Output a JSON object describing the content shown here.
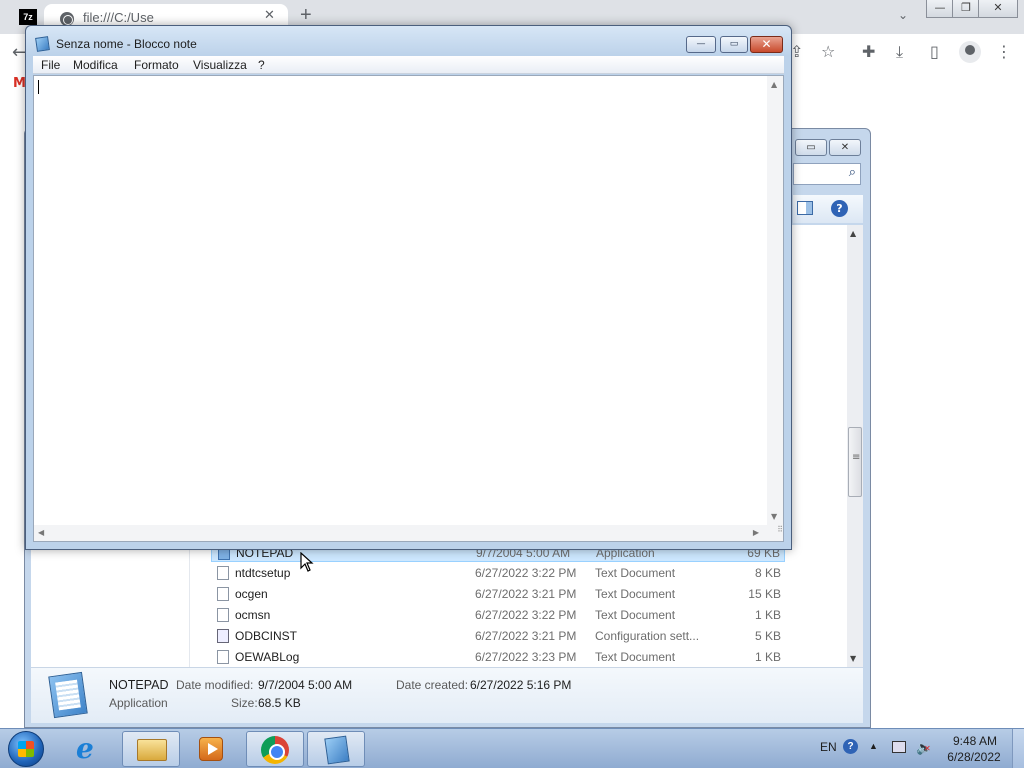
{
  "chrome": {
    "app_icon_label": "7z",
    "tab_title": "file:///C:/Use",
    "tab_close": "✕",
    "new_tab": "+",
    "tab_search_chevron": "⌄",
    "window_min": "—",
    "window_restore": "❐",
    "window_close": "✕",
    "back_arrow": "←",
    "toolbar_icons": [
      "share-icon",
      "star-icon",
      "extensions-icon",
      "download-icon",
      "sidebar-icon",
      "profile-icon",
      "menu-icon"
    ],
    "toolbar_glyphs": [
      "⇪",
      "☆",
      "✚",
      "⤓",
      "▯",
      "⋮"
    ],
    "bookmark_gmail": "M"
  },
  "notepad": {
    "title": "Senza nome - Blocco note",
    "menu": [
      "File",
      "Modifica",
      "Formato",
      "Visualizza",
      "?"
    ],
    "content": "",
    "buttons": {
      "minimize": "—",
      "maximize": "▭",
      "close": "✕"
    },
    "scroll_glyphs": {
      "up": "▲",
      "down": "▼",
      "left": "◀",
      "right": "▶",
      "grip": "⠿"
    }
  },
  "explorer": {
    "search_icon": "⌕",
    "help_label": "?",
    "buttons": {
      "maximize": "▭",
      "close": "✕"
    },
    "scroll_glyphs": {
      "up": "▲",
      "down": "▼"
    },
    "files": [
      {
        "name": "NOTEPAD",
        "date": "9/7/2004 5:00 AM",
        "type": "Application",
        "size": "69 KB",
        "icon": "application-icon",
        "selected": true
      },
      {
        "name": "ntdtcsetup",
        "date": "6/27/2022 3:22 PM",
        "type": "Text Document",
        "size": "8 KB",
        "icon": "text-document-icon",
        "selected": false
      },
      {
        "name": "ocgen",
        "date": "6/27/2022 3:21 PM",
        "type": "Text Document",
        "size": "15 KB",
        "icon": "text-document-icon",
        "selected": false
      },
      {
        "name": "ocmsn",
        "date": "6/27/2022 3:22 PM",
        "type": "Text Document",
        "size": "1 KB",
        "icon": "text-document-icon",
        "selected": false
      },
      {
        "name": "ODBCINST",
        "date": "6/27/2022 3:21 PM",
        "type": "Configuration sett...",
        "size": "5 KB",
        "icon": "config-settings-icon",
        "selected": false
      },
      {
        "name": "OEWABLog",
        "date": "6/27/2022 3:23 PM",
        "type": "Text Document",
        "size": "1 KB",
        "icon": "text-document-icon",
        "selected": false
      }
    ],
    "details": {
      "name": "NOTEPAD",
      "type": "Application",
      "date_modified_label": "Date modified:",
      "date_modified": "9/7/2004 5:00 AM",
      "date_created_label": "Date created:",
      "date_created": "6/27/2022 5:16 PM",
      "size_label": "Size:",
      "size": "68.5 KB"
    }
  },
  "taskbar": {
    "items": [
      "start-button",
      "internet-explorer",
      "windows-explorer",
      "media-player",
      "google-chrome",
      "notepad"
    ],
    "language": "EN",
    "help": "?",
    "tray_arrow": "▲",
    "volume_glyph": "🔈",
    "time": "9:48 AM",
    "date": "6/28/2022"
  }
}
